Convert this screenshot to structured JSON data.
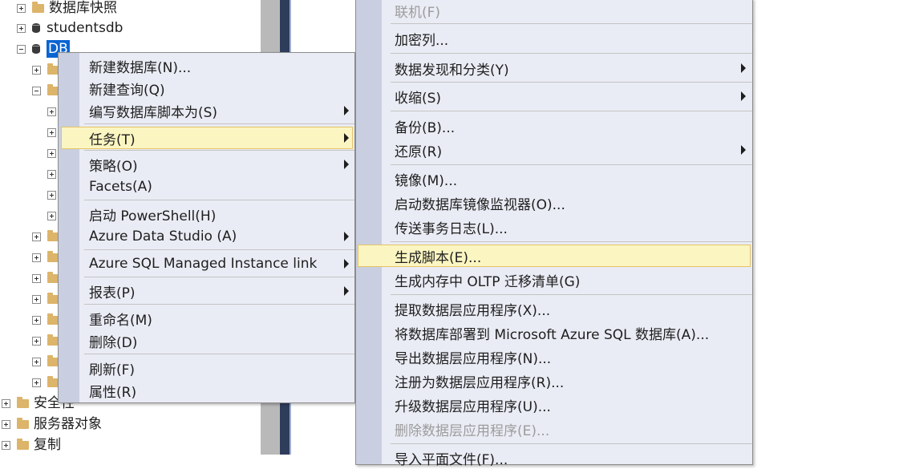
{
  "tree": {
    "snapshots_label": "数据库快照",
    "studentsdb_label": "studentsdb",
    "db_label": "DB",
    "security_label": "安全性",
    "server_objects_label": "服务器对象",
    "replication_label": "复制"
  },
  "context_menu": {
    "new_database": "新建数据库(N)...",
    "new_query": "新建查询(Q)",
    "script_database_as": "编写数据库脚本为(S)",
    "tasks": "任务(T)",
    "policies": "策略(O)",
    "facets": "Facets(A)",
    "start_powershell": "启动 PowerShell(H)",
    "azure_data_studio": "Azure Data Studio (A)",
    "azure_sql_mi_link": "Azure SQL Managed Instance link",
    "reports": "报表(P)",
    "rename": "重命名(M)",
    "delete": "删除(D)",
    "refresh": "刷新(F)",
    "properties": "属性(R)"
  },
  "tasks_menu": {
    "online": "联机(F)",
    "encrypt_columns": "加密列...",
    "data_discovery": "数据发现和分类(Y)",
    "shrink": "收缩(S)",
    "backup": "备份(B)...",
    "restore": "还原(R)",
    "mirror": "镜像(M)...",
    "launch_mirror_monitor": "启动数据库镜像监视器(O)...",
    "ship_transaction_logs": "传送事务日志(L)...",
    "generate_scripts": "生成脚本(E)...",
    "generate_inmemory_checklists": "生成内存中 OLTP 迁移清单(G)",
    "extract_data_tier_app": "提取数据层应用程序(X)...",
    "deploy_to_azure_sql": "将数据库部署到 Microsoft Azure SQL 数据库(A)...",
    "export_data_tier_app": "导出数据层应用程序(N)...",
    "register_data_tier_app": "注册为数据层应用程序(R)...",
    "upgrade_data_tier_app": "升级数据层应用程序(U)...",
    "delete_data_tier_app": "删除数据层应用程序(E)...",
    "import_flat_file": "导入平面文件(F)..."
  },
  "colors": {
    "menu_background": "#eaecf5",
    "menu_gutter": "#c9cfe0",
    "highlight_fill": "#fbf5c2",
    "highlight_border": "#e5c365",
    "selection_blue": "#0a64d2",
    "folder_yellow": "#dcb46a",
    "disabled_text": "#9c9c9c"
  },
  "icons": {
    "expander": "plus-minus-box",
    "folder": "folder-icon",
    "database": "database-cylinder-icon",
    "submenu": "right-triangle-arrow"
  }
}
